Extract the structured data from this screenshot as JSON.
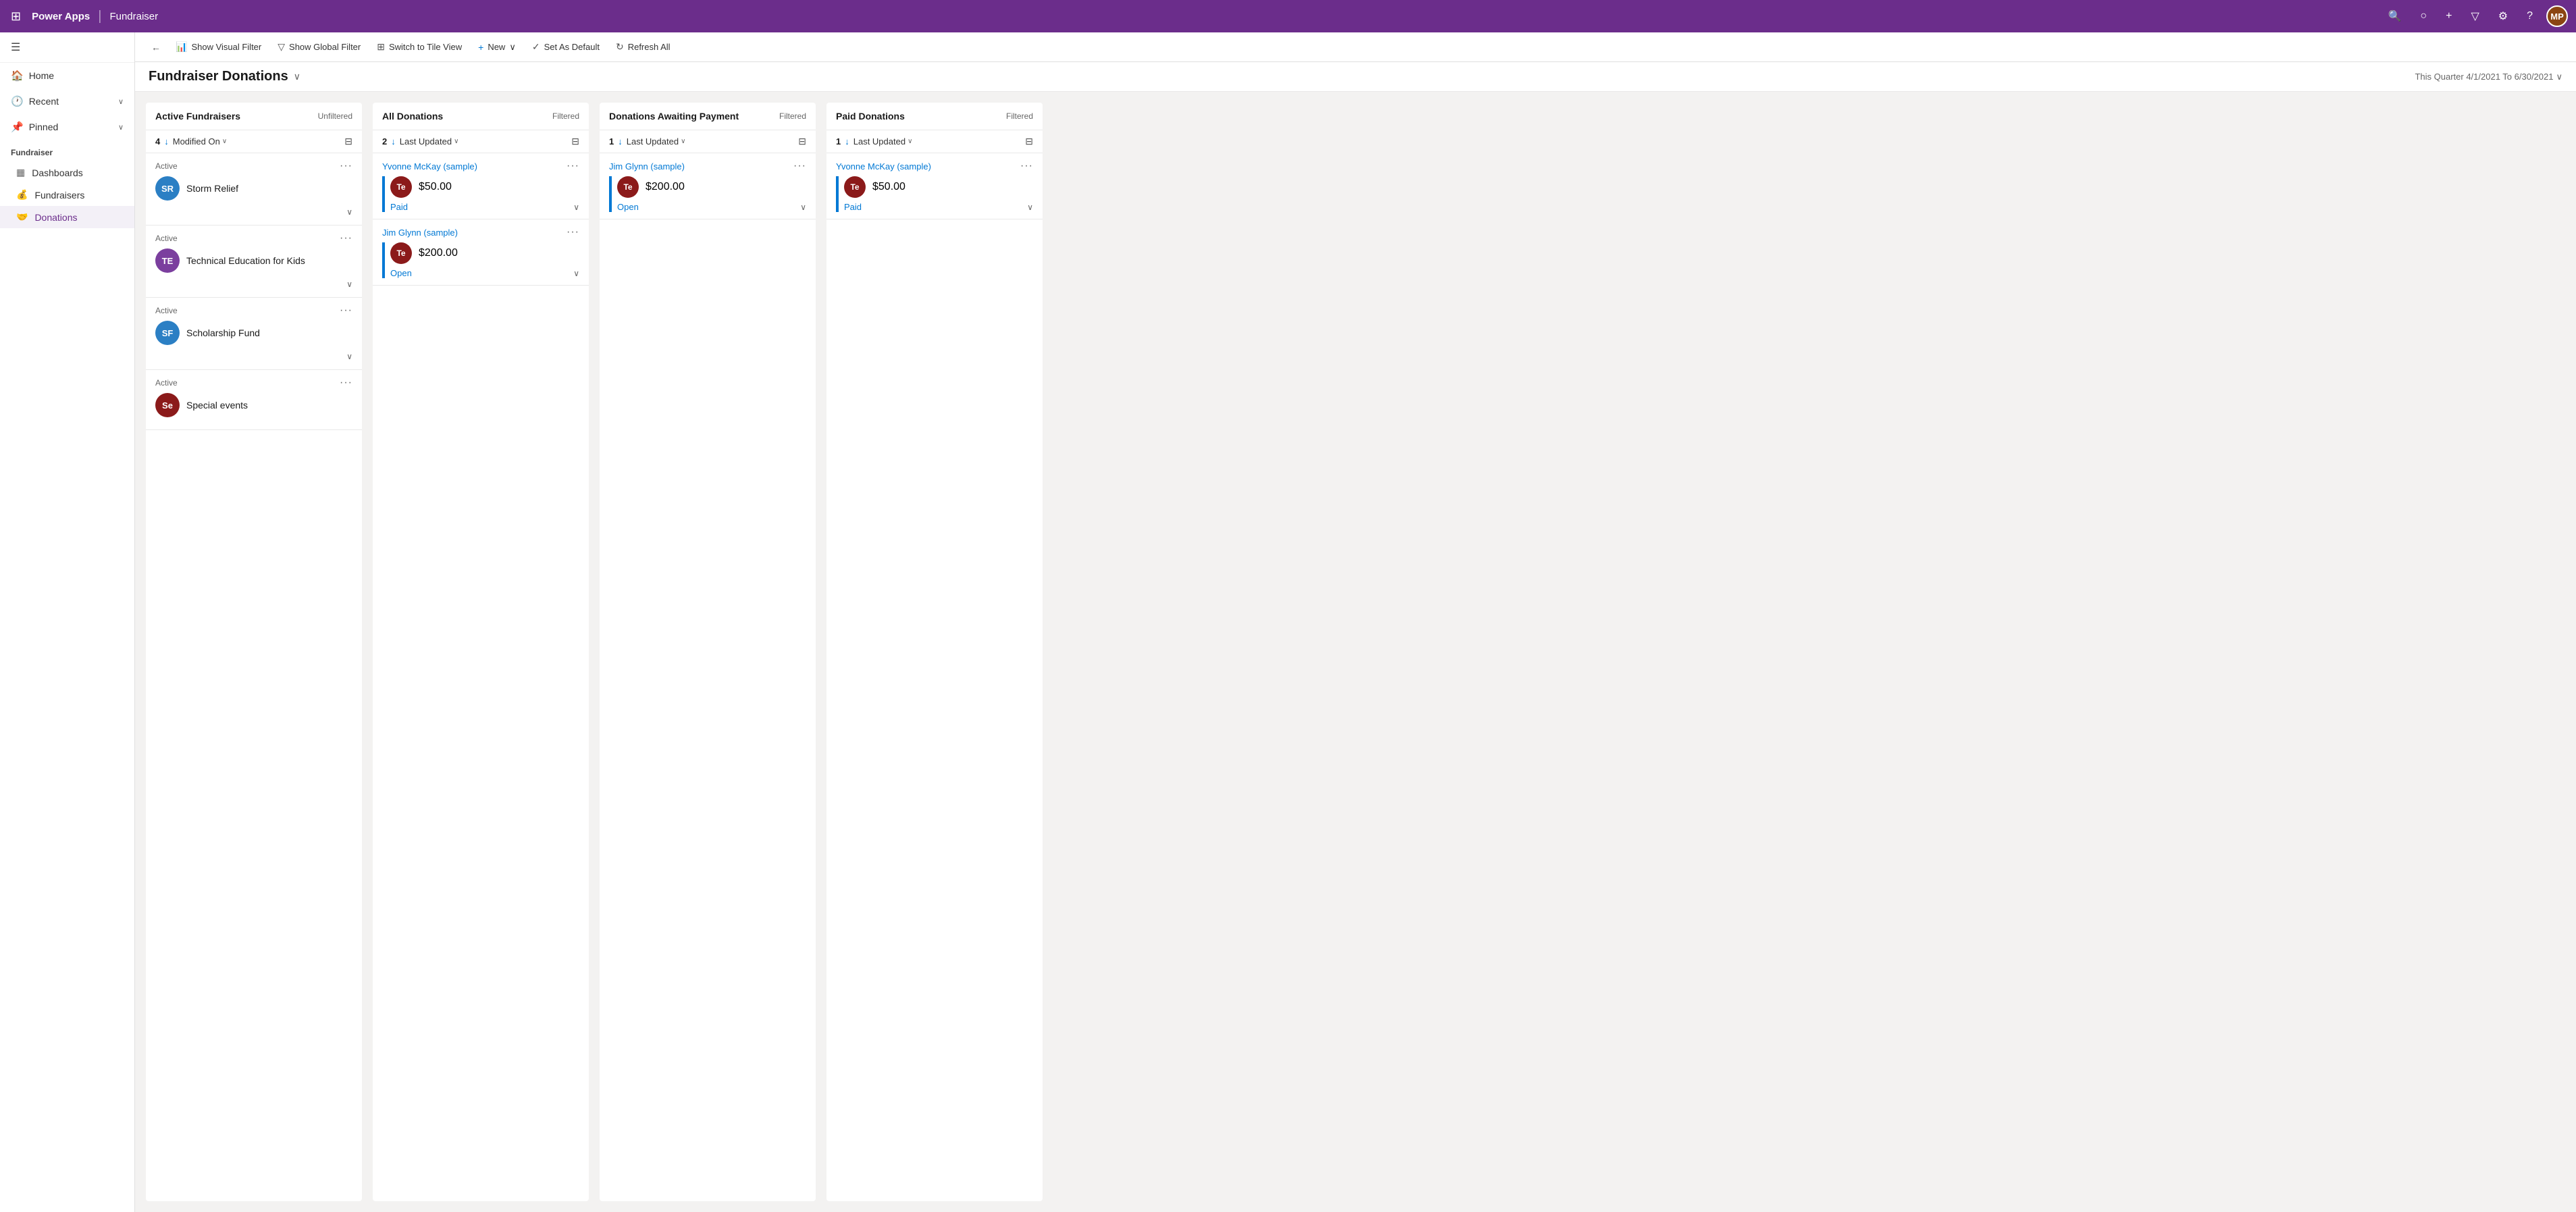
{
  "topnav": {
    "logo": "Power Apps",
    "divider": "|",
    "appname": "Fundraiser",
    "icons": [
      "⊞",
      "🔍",
      "○",
      "+",
      "▽",
      "⚙",
      "?"
    ],
    "avatar": "MP"
  },
  "sidebar": {
    "hamburger": "☰",
    "nav_items": [
      {
        "id": "home",
        "icon": "🏠",
        "label": "Home",
        "has_chevron": false
      },
      {
        "id": "recent",
        "icon": "🕐",
        "label": "Recent",
        "has_chevron": true
      },
      {
        "id": "pinned",
        "icon": "📌",
        "label": "Pinned",
        "has_chevron": true
      }
    ],
    "section_label": "Fundraiser",
    "sub_items": [
      {
        "id": "dashboards",
        "icon": "▦",
        "label": "Dashboards"
      },
      {
        "id": "fundraisers",
        "icon": "💰",
        "label": "Fundraisers"
      },
      {
        "id": "donations",
        "icon": "🤝",
        "label": "Donations",
        "active": true
      }
    ]
  },
  "toolbar": {
    "back_icon": "←",
    "show_visual_filter": "Show Visual Filter",
    "show_global_filter": "Show Global Filter",
    "switch_to_tile_view": "Switch to Tile View",
    "new_label": "New",
    "new_chevron": "∨",
    "set_as_default": "Set As Default",
    "refresh_all": "Refresh All"
  },
  "page_header": {
    "title": "Fundraiser Donations",
    "title_chevron": "∨",
    "date_range": "This Quarter 4/1/2021 To 6/30/2021",
    "date_range_chevron": "∨"
  },
  "columns": [
    {
      "id": "active-fundraisers",
      "title": "Active Fundraisers",
      "filter": "Unfiltered",
      "count": 4,
      "sort_field": "Modified On",
      "cards": [
        {
          "status": "Active",
          "avatar_text": "SR",
          "avatar_color": "#2b7fc4",
          "name": "Storm Relief",
          "show_expand": true
        },
        {
          "status": "Active",
          "avatar_text": "TE",
          "avatar_color": "#7b3f9e",
          "name": "Technical Education for Kids",
          "show_expand": true
        },
        {
          "status": "Active",
          "avatar_text": "SF",
          "avatar_color": "#2b7fc4",
          "name": "Scholarship Fund",
          "show_expand": true
        },
        {
          "status": "Active",
          "avatar_text": "Se",
          "avatar_color": "#8b1a1a",
          "name": "Special events",
          "show_expand": false
        }
      ]
    },
    {
      "id": "all-donations",
      "title": "All Donations",
      "filter": "Filtered",
      "count": 2,
      "sort_field": "Last Updated",
      "cards": [
        {
          "donor_name": "Yvonne McKay (sample)",
          "avatar_text": "Te",
          "avatar_color": "#8b1a1a",
          "amount": "$50.00",
          "status": "Paid",
          "has_blue_bar": true
        },
        {
          "donor_name": "Jim Glynn (sample)",
          "avatar_text": "Te",
          "avatar_color": "#8b1a1a",
          "amount": "$200.00",
          "status": "Open",
          "has_blue_bar": true
        }
      ]
    },
    {
      "id": "donations-awaiting-payment",
      "title": "Donations Awaiting Payment",
      "filter": "Filtered",
      "count": 1,
      "sort_field": "Last Updated",
      "cards": [
        {
          "donor_name": "Jim Glynn (sample)",
          "avatar_text": "Te",
          "avatar_color": "#8b1a1a",
          "amount": "$200.00",
          "status": "Open",
          "has_blue_bar": true
        }
      ]
    },
    {
      "id": "paid-donations",
      "title": "Paid Donations",
      "filter": "Filtered",
      "count": 1,
      "sort_field": "Last Updated",
      "cards": [
        {
          "donor_name": "Yvonne McKay (sample)",
          "avatar_text": "Te",
          "avatar_color": "#8b1a1a",
          "amount": "$50.00",
          "status": "Paid",
          "has_blue_bar": true
        }
      ]
    }
  ]
}
